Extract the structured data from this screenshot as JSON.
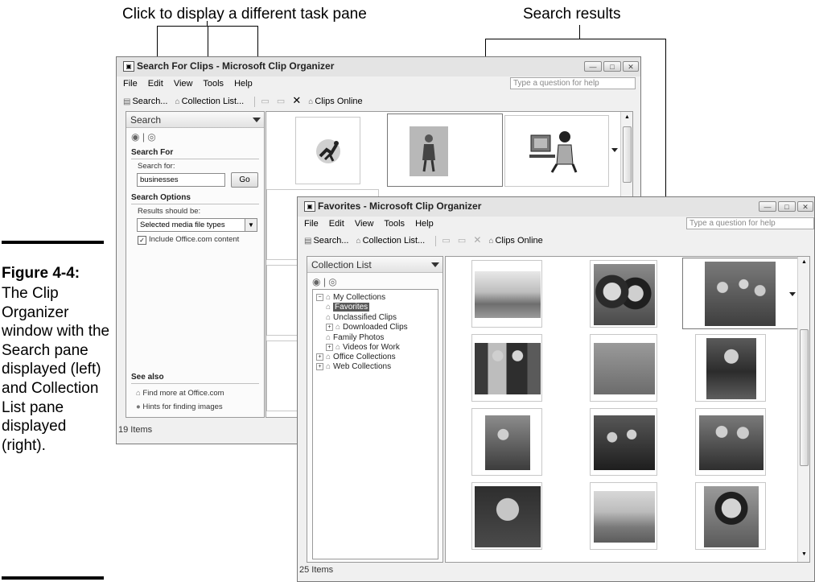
{
  "callouts": {
    "task_pane": "Click to display a different task pane",
    "results": "Search results"
  },
  "caption": {
    "label": "Figure 4-4:",
    "text": "The Clip Organizer window with the Search pane displayed (left) and Collection List pane displayed (right)."
  },
  "back_window": {
    "title": "Search For Clips - Microsoft Clip Organizer",
    "menu": [
      "File",
      "Edit",
      "View",
      "Tools",
      "Help"
    ],
    "help_placeholder": "Type a question for help",
    "toolbar": {
      "search": "Search...",
      "collection_list": "Collection List...",
      "clips_online": "Clips Online"
    },
    "pane": {
      "title": "Search",
      "search_for_heading": "Search For",
      "search_for_label": "Search for:",
      "search_value": "businesses",
      "go": "Go",
      "options_heading": "Search Options",
      "results_label": "Results should be:",
      "results_value": "Selected media file types",
      "include_label": "Include Office.com content",
      "include_checked": true,
      "see_also_heading": "See also",
      "link_find_more": "Find more at Office.com",
      "link_hints": "Hints for finding images"
    },
    "status": "19 Items"
  },
  "front_window": {
    "title": "Favorites - Microsoft Clip Organizer",
    "menu": [
      "File",
      "Edit",
      "View",
      "Tools",
      "Help"
    ],
    "help_placeholder": "Type a question for help",
    "toolbar": {
      "search": "Search...",
      "collection_list": "Collection List...",
      "clips_online": "Clips Online"
    },
    "pane": {
      "title": "Collection List",
      "tree": [
        {
          "label": "My Collections",
          "level": 0,
          "expander": "−"
        },
        {
          "label": "Favorites",
          "level": 1,
          "expander": "",
          "selected": true
        },
        {
          "label": "Unclassified Clips",
          "level": 1,
          "expander": ""
        },
        {
          "label": "Downloaded Clips",
          "level": 1,
          "expander": "+"
        },
        {
          "label": "Family Photos",
          "level": 1,
          "expander": ""
        },
        {
          "label": "Videos for Work",
          "level": 1,
          "expander": "+"
        },
        {
          "label": "Office Collections",
          "level": 0,
          "expander": "+"
        },
        {
          "label": "Web Collections",
          "level": 0,
          "expander": "+"
        }
      ]
    },
    "status": "25 Items"
  },
  "colors": {
    "chrome": "#f0f0f0",
    "border": "#7a7a7a",
    "selection": "#5a5a5a"
  }
}
